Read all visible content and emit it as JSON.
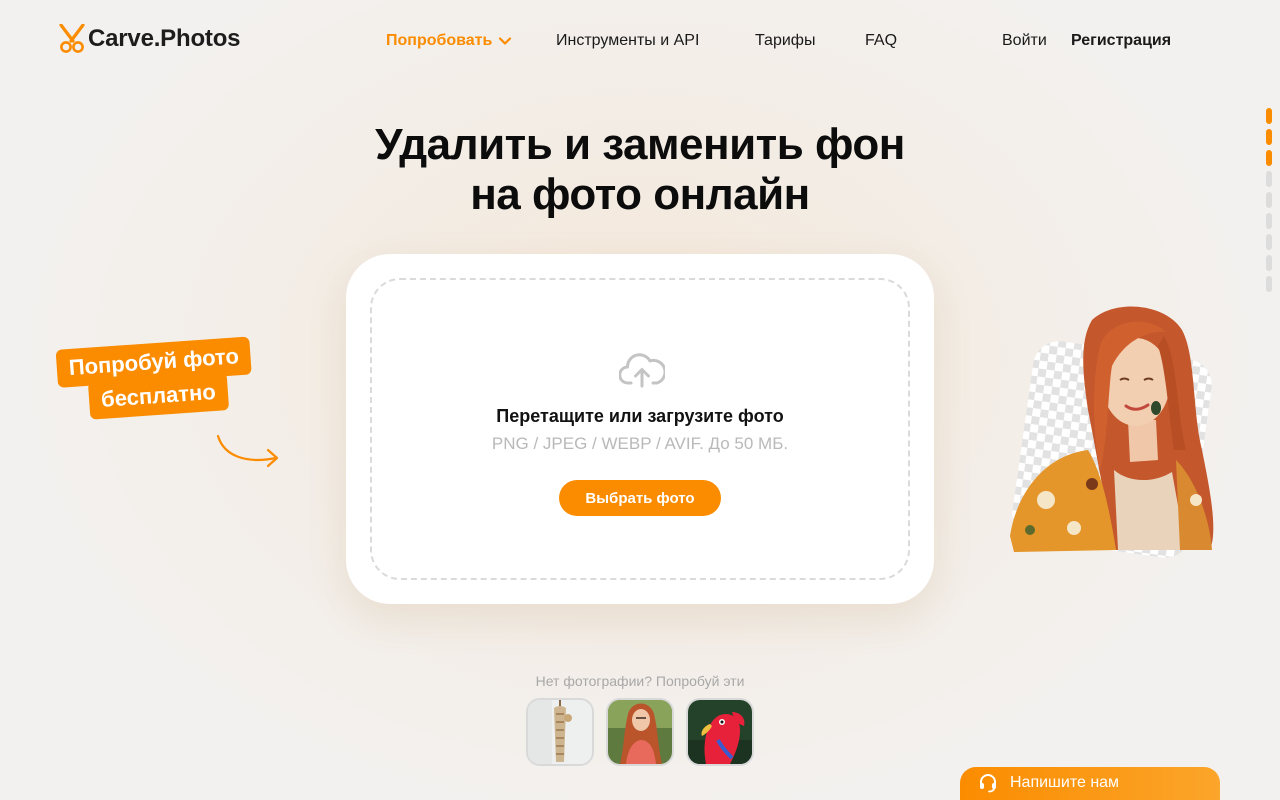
{
  "header": {
    "logo_text": "Carve.Photos",
    "nav": {
      "try": "Попробовать",
      "tools": "Инструменты и API",
      "pricing": "Тарифы",
      "faq": "FAQ"
    },
    "login": "Войти",
    "signup": "Регистрация"
  },
  "hero": {
    "title_line1": "Удалить и заменить фон",
    "title_line2": "на фото онлайн"
  },
  "upload": {
    "title": "Перетащите или загрузите фото",
    "formats": "PNG / JPEG / WEBP / AVIF. До 50 МБ.",
    "button": "Выбрать фото"
  },
  "promo": {
    "line1": "Попробуй фото",
    "line2": "бесплатно"
  },
  "samples": {
    "label": "Нет фотографии? Попробуй эти",
    "items": [
      "vase-sample",
      "woman-sample",
      "parrot-sample"
    ]
  },
  "chat": {
    "label": "Напишите нам"
  },
  "scroll_indicator": {
    "total": 9,
    "active": 3
  },
  "colors": {
    "accent": "#fb8c00",
    "text": "#111111",
    "muted": "#b9b9b9"
  }
}
